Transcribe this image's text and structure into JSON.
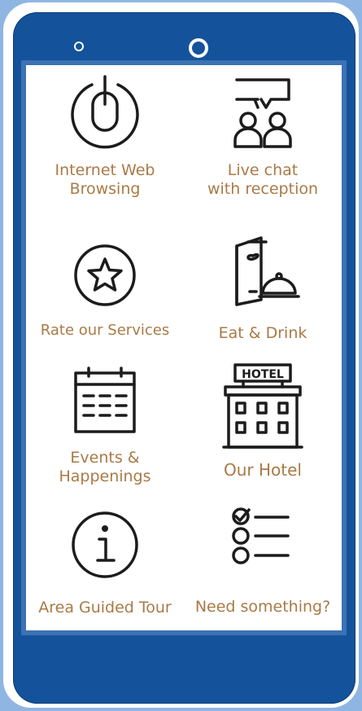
{
  "menu": {
    "items": [
      {
        "label": "Internet Web\nBrowsing",
        "icon": "mouse-icon"
      },
      {
        "label": "Live chat\nwith reception",
        "icon": "chat-people-icon"
      },
      {
        "label": "Rate our Services",
        "icon": "star-icon"
      },
      {
        "label": "Eat & Drink",
        "icon": "menu-cloche-icon"
      },
      {
        "label": "Events &\nHappenings",
        "icon": "calendar-icon"
      },
      {
        "label": "Our Hotel",
        "icon": "hotel-building-icon"
      },
      {
        "label": "Area Guided Tour",
        "icon": "info-icon"
      },
      {
        "label": "Need something?",
        "icon": "checklist-icon"
      }
    ],
    "hotel_sign_text": "HOTEL"
  },
  "colors": {
    "phone_body": "#14539b",
    "screen_frame": "#3c72b3",
    "label_text": "#a97a46",
    "background": "#8fb6e3"
  }
}
